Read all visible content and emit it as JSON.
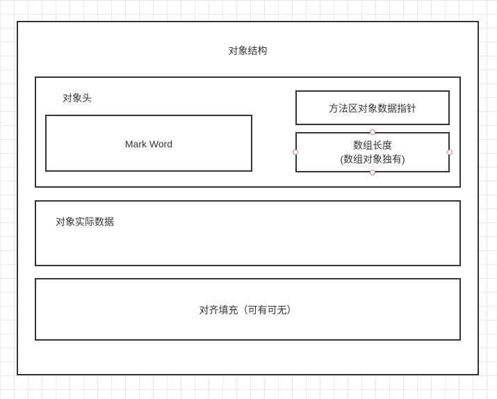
{
  "diagram": {
    "title": "对象结构",
    "header": {
      "label": "对象头",
      "mark_word": "Mark Word",
      "method_pointer": "方法区对象数据指针",
      "array_length": "数组长度\n(数组对象独有)"
    },
    "instance_data": "对象实际数据",
    "padding": "对齐填充（可有可无）"
  }
}
